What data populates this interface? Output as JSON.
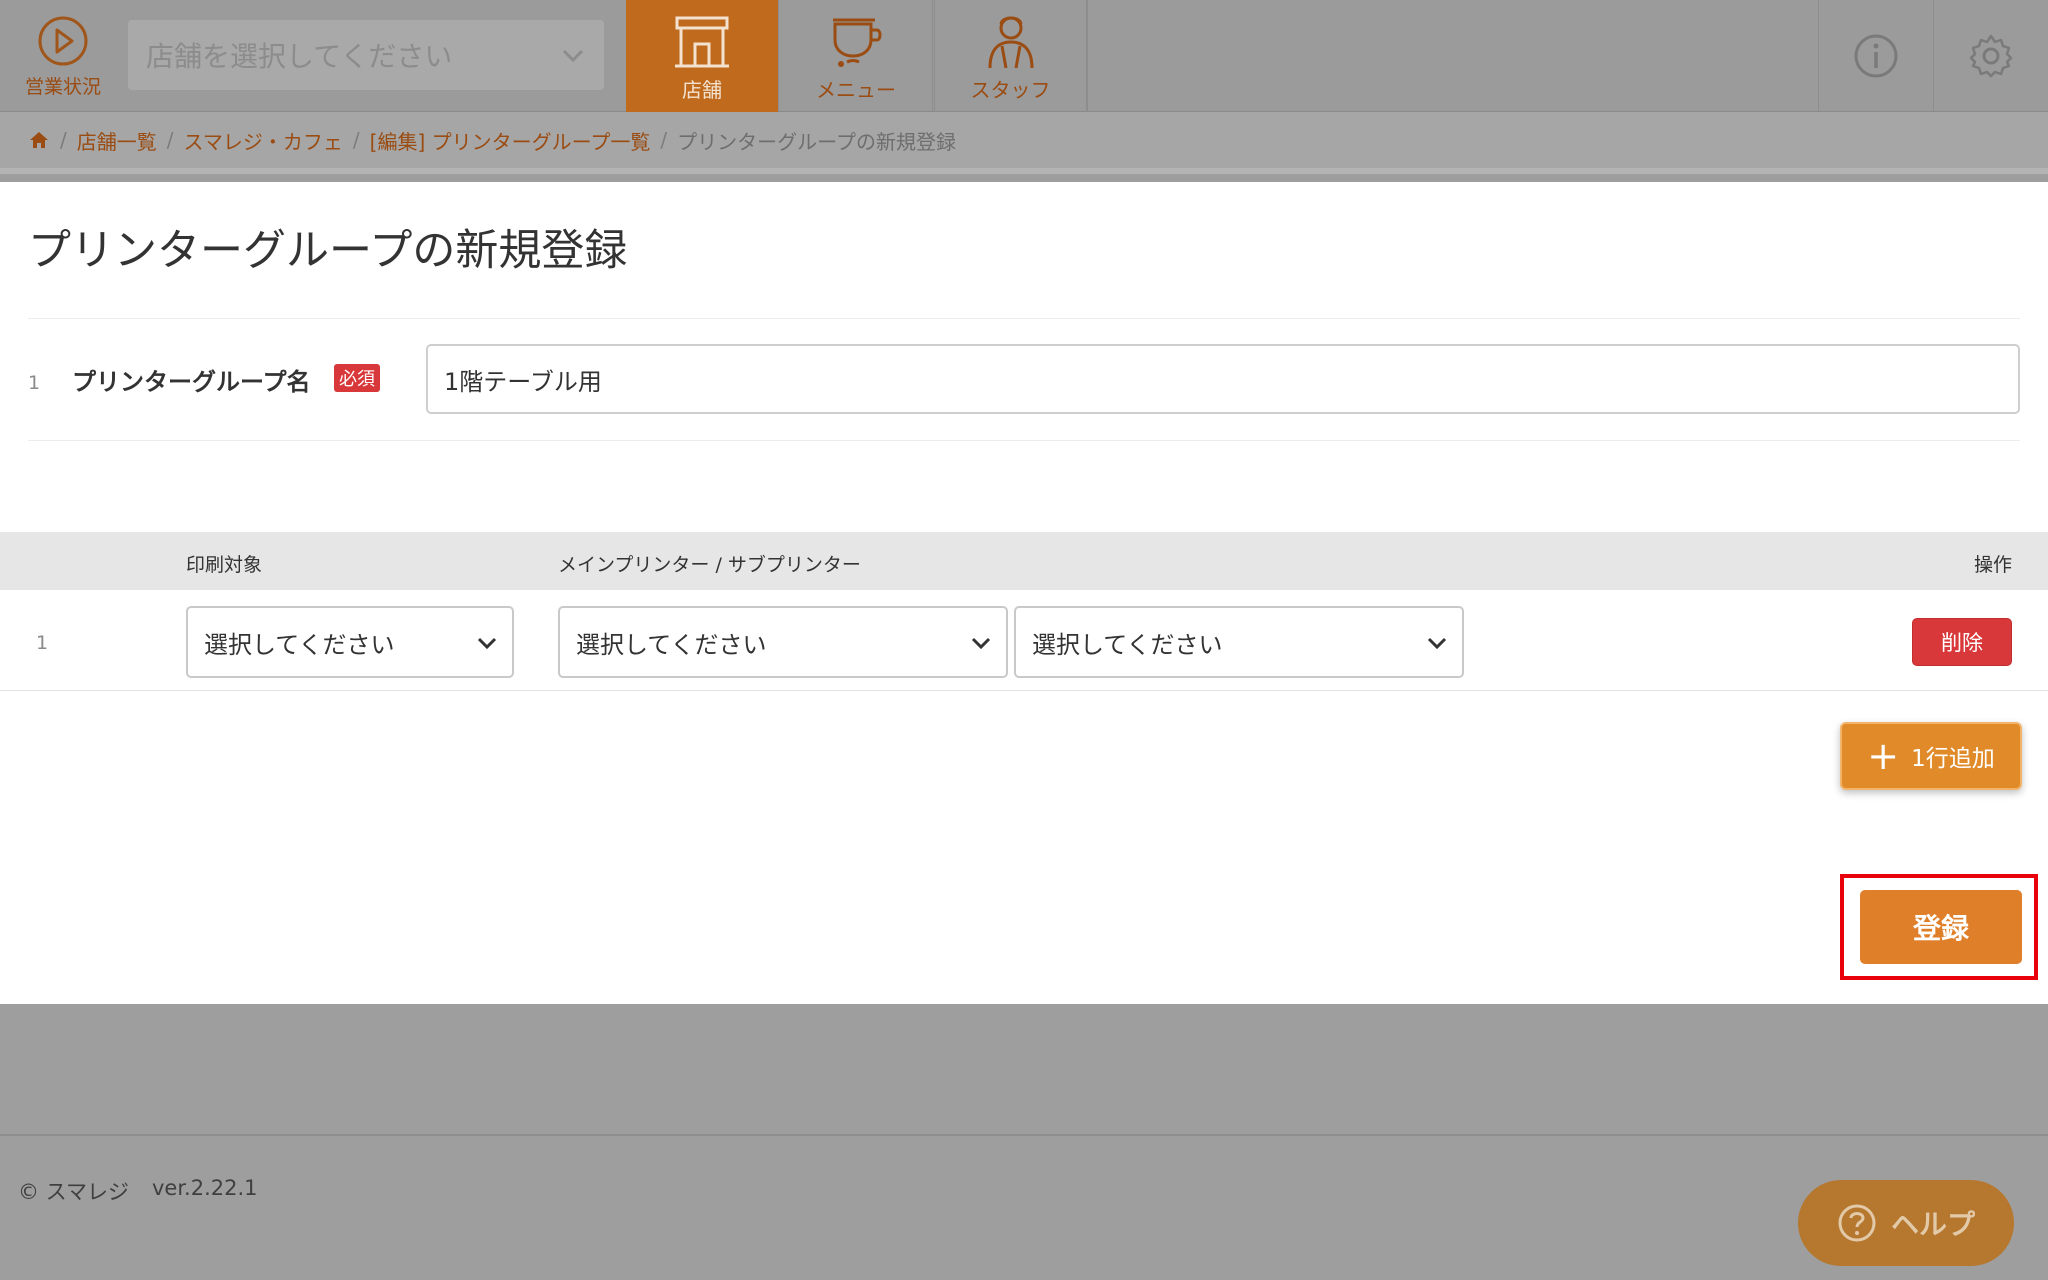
{
  "topbar": {
    "status_label": "営業状況",
    "store_select_placeholder": "店舗を選択してください",
    "tabs": [
      {
        "label": "店舗",
        "active": true
      },
      {
        "label": "メニュー",
        "active": false
      },
      {
        "label": "スタッフ",
        "active": false
      }
    ]
  },
  "breadcrumb": {
    "items": [
      "店舗一覧",
      "スマレジ・カフェ",
      "[編集] プリンターグループ一覧"
    ],
    "current": "プリンターグループの新規登録"
  },
  "page_title": "プリンターグループの新規登録",
  "form": {
    "row_number": "1",
    "name_label": "プリンターグループ名",
    "required_badge": "必須",
    "name_value": "1階テーブル用"
  },
  "table": {
    "headers": {
      "target": "印刷対象",
      "printer": "メインプリンター / サブプリンター",
      "operation": "操作"
    },
    "rows": [
      {
        "number": "1",
        "target": "選択してください",
        "main_printer": "選択してください",
        "sub_printer": "選択してください",
        "delete_label": "削除"
      }
    ],
    "add_row_label": "1行追加"
  },
  "register_label": "登録",
  "footer": {
    "copyright": "© スマレジ",
    "version": "ver.2.22.1",
    "help_label": "ヘルプ"
  },
  "colors": {
    "accent": "#e07f2a",
    "active_tab": "#c06a1e",
    "danger": "#d9383a",
    "highlight": "#e8000b"
  }
}
